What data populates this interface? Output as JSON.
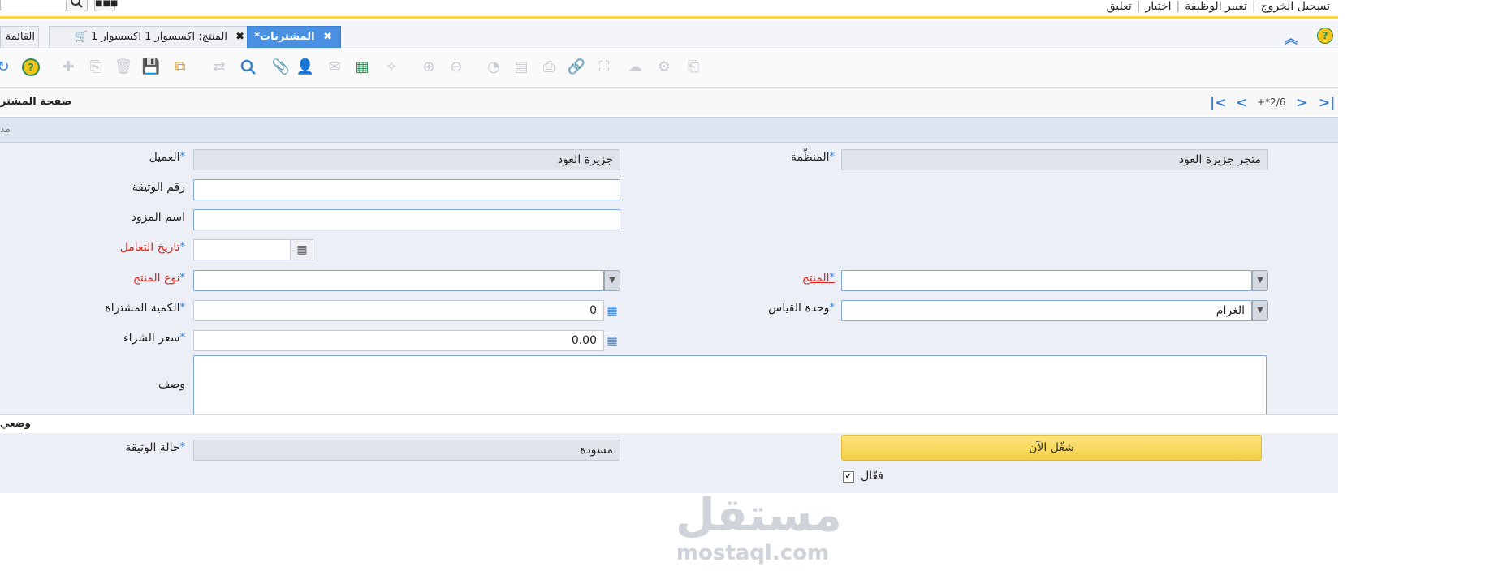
{
  "top_menu": {
    "items": [
      "تسجيل الخروج",
      "تغيير الوظيفة",
      "اختيار",
      "تعليق"
    ]
  },
  "tabs": [
    {
      "label": "المشتريات*",
      "close": "✖",
      "active": true
    },
    {
      "label": "المنتج: اكسسوار 1 اكسسوار 1",
      "close": "✖",
      "active": false
    },
    {
      "label": "القائمة",
      "close": "",
      "active": false
    }
  ],
  "record_nav": {
    "title": "صفحة المشتر",
    "count": "+*2/6"
  },
  "form": {
    "org_label": "المنظّمة",
    "org_value": "متجر جزيرة العود",
    "client_label": "العميل",
    "client_value": "جزيرة العود",
    "doc_no_label": "رقم الوثيقة",
    "doc_no_value": "",
    "vendor_label": "اسم المزود",
    "vendor_value": "",
    "trx_date_label": "تاريخ التعامل",
    "trx_date_value": "",
    "product_label": "المنتج",
    "product_value": "",
    "product_type_label": "نوع المنتج",
    "product_type_value": "",
    "uom_label": "وحدة القياس",
    "uom_value": "الغرام",
    "qty_label": "الكمية المشتراة",
    "qty_value": "0",
    "price_label": "سعر الشراء",
    "price_value": "0.00",
    "desc_label": "وصف",
    "desc_value": ""
  },
  "status_section": {
    "title": "وضعي",
    "doc_status_label": "حالة الوثيقة",
    "doc_status_value": "مسودة",
    "run_button": "شغّل الآن",
    "active_label": "فعّال",
    "active_checked": true
  },
  "band_text": "مد",
  "watermark": {
    "arabic": "مستقل",
    "latin": "mostaql.com"
  },
  "colors": {
    "accent": "#4a90e2",
    "required": "#d9251c",
    "highlight": "#f7d64a"
  }
}
